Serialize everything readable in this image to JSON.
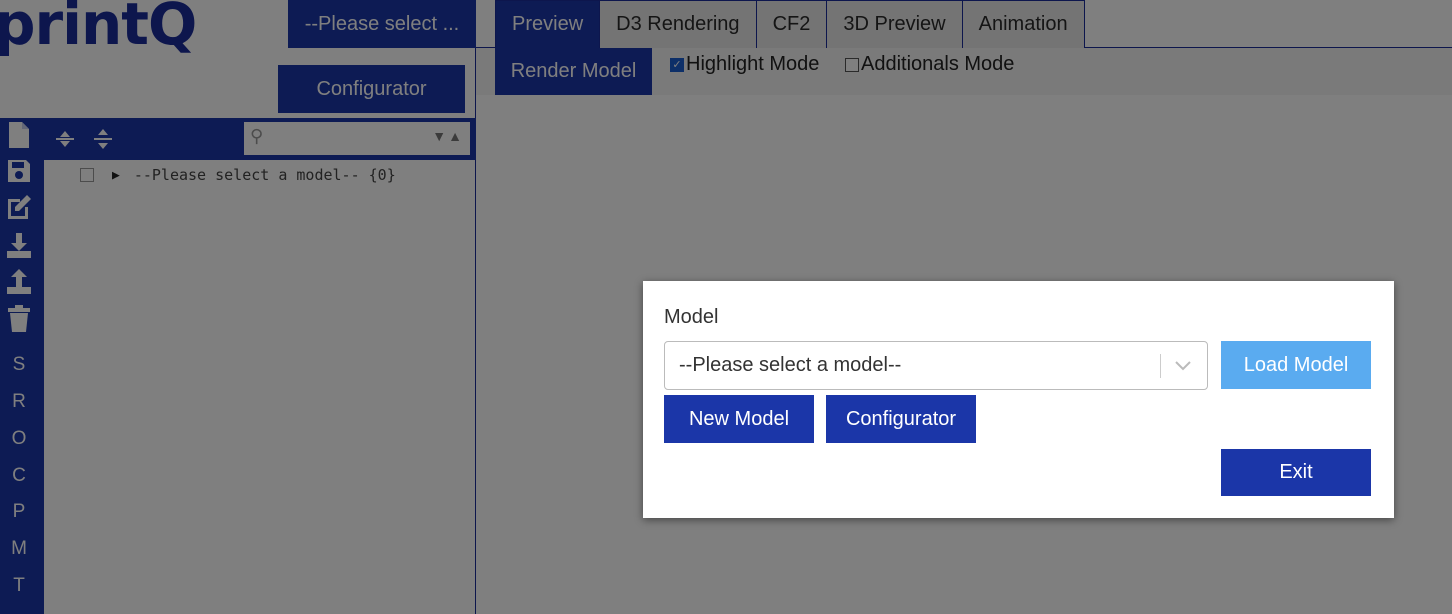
{
  "app": {
    "logo_text": "printQ"
  },
  "header": {
    "model_select_label": "--Please select ...",
    "configurator_label": "Configurator"
  },
  "tabs": [
    {
      "label": "Preview",
      "active": true
    },
    {
      "label": "D3 Rendering",
      "active": false
    },
    {
      "label": "CF2",
      "active": false
    },
    {
      "label": "3D Preview",
      "active": false
    },
    {
      "label": "Animation",
      "active": false
    }
  ],
  "subbar": {
    "render_button_label": "Render Model",
    "highlight_mode": {
      "label": "Highlight Mode",
      "checked": true
    },
    "additionals_mode": {
      "label": "Additionals Mode",
      "checked": false
    }
  },
  "sidebar": {
    "icons": [
      "new-file-icon",
      "save-icon",
      "edit-icon",
      "download-icon",
      "upload-icon",
      "trash-icon"
    ],
    "letters": [
      "S",
      "R",
      "O",
      "C",
      "P",
      "M",
      "T"
    ]
  },
  "tree": {
    "toolbar_icons": [
      "collapse-all-icon",
      "expand-all-icon"
    ],
    "search_placeholder": "",
    "root_node_label": "--Please select a model-- {0}"
  },
  "modal": {
    "label": "Model",
    "select_value": "--Please select a model--",
    "load_button": "Load Model",
    "new_button": "New Model",
    "configurator_button": "Configurator",
    "exit_button": "Exit"
  },
  "colors": {
    "primary": "#1b36a8",
    "load_button": "#5aabf0",
    "logo": "#1b2c9a"
  }
}
